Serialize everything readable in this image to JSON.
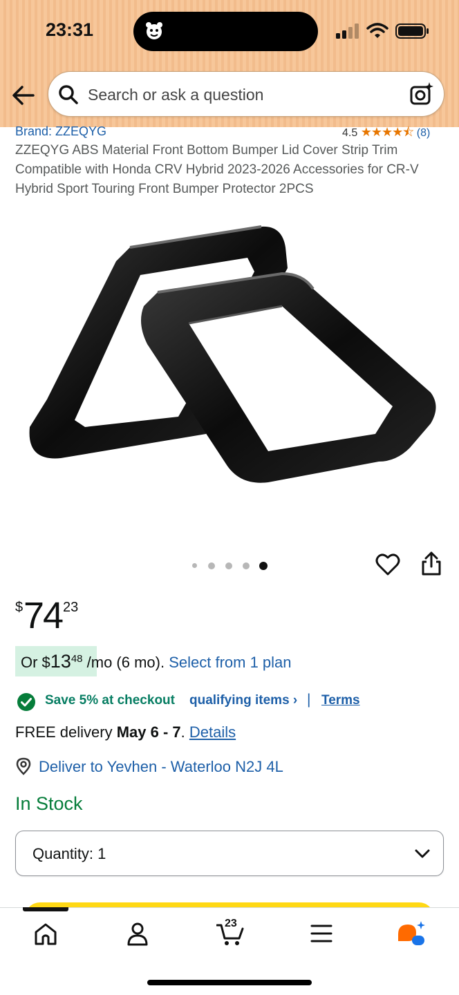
{
  "status_bar": {
    "time": "23:31"
  },
  "search": {
    "placeholder": "Search or ask a question"
  },
  "product": {
    "brand": "Brand: ZZEQYG",
    "rating": "4.5",
    "rating_stars": "★★★★⯪",
    "rating_count": "(8)",
    "title": "ZZEQYG ABS Material Front Bottom Bumper Lid Cover Strip Trim Compatible with Honda CRV Hybrid 2023-2026 Accessories for CR-V Hybrid Sport Touring Front Bumper Protector 2PCS",
    "image_index": 5,
    "image_count": 5
  },
  "price": {
    "symbol": "$",
    "whole": "74",
    "fraction": "23"
  },
  "monthly": {
    "prefix": "Or $",
    "whole": "13",
    "fraction": "48",
    "suffix": " /mo (6 mo). ",
    "link": "Select from 1 plan"
  },
  "promo": {
    "save": "Save 5% at checkout",
    "qualifying": "qualifying items ›",
    "separator": "|",
    "terms": "Terms"
  },
  "delivery": {
    "prefix": "FREE delivery ",
    "date": "May 6 - 7",
    "period": ". ",
    "details": "Details"
  },
  "location": {
    "text": "Deliver to Yevhen - Waterloo N2J 4L"
  },
  "stock": {
    "text": "In Stock"
  },
  "quantity": {
    "label": "Quantity: 1"
  },
  "nav": {
    "cart_count": "23"
  },
  "colors": {
    "link": "#1d5fa8",
    "save_green": "#067d62",
    "stock_green": "#067d3a",
    "header_bg": "#f7c79a",
    "cart_button": "#ffd814",
    "rating_orange": "#e77600"
  }
}
